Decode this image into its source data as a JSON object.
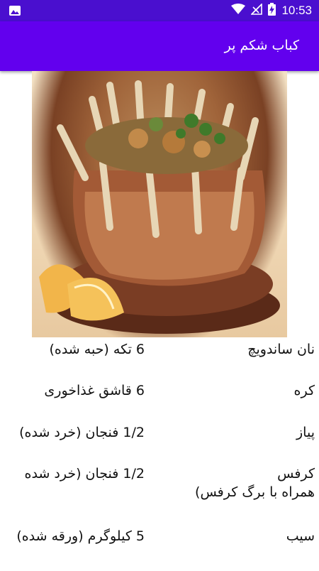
{
  "status_bar": {
    "time": "10:53",
    "colors": {
      "bar": "#4a0fcf"
    }
  },
  "app_bar": {
    "title": "کباب شکم پر",
    "color": "#6200ee"
  },
  "recipe_image": {
    "icon": "crown-roast-photo"
  },
  "ingredients": [
    {
      "name": "نان ساندویچ",
      "quantity": "6 تکه (حبه شده)"
    },
    {
      "name": "کره",
      "quantity": "6 قاشق غذاخوری"
    },
    {
      "name": "پیاز",
      "quantity": "1/2 فنجان (خرد شده)"
    },
    {
      "name": "کرفس",
      "name_line2": "همراه با برگ کرفس)",
      "quantity": "1/2 فنجان (خرد شده"
    },
    {
      "name": "سیب",
      "quantity": "5 کیلوگرم (ورقه شده)"
    }
  ]
}
